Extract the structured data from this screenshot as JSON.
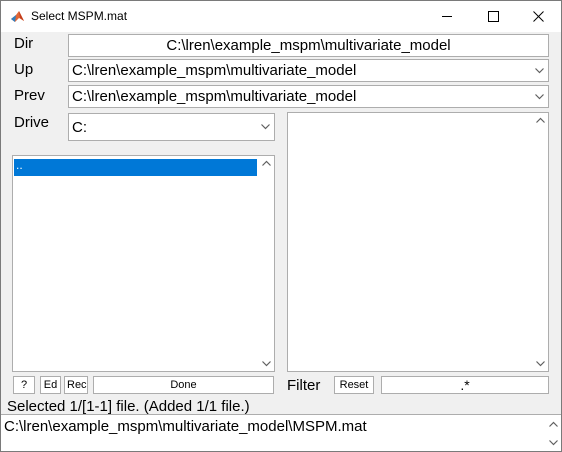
{
  "window": {
    "title": "Select MSPM.mat",
    "minimize_icon": "minimize-icon",
    "maximize_icon": "maximize-icon",
    "close_icon": "close-icon"
  },
  "dir": {
    "label": "Dir",
    "value": "C:\\lren\\example_mspm\\multivariate_model"
  },
  "up": {
    "label": "Up",
    "value": "C:\\lren\\example_mspm\\multivariate_model"
  },
  "prev": {
    "label": "Prev",
    "value": "C:\\lren\\example_mspm\\multivariate_model"
  },
  "drive": {
    "label": "Drive",
    "value": "C:"
  },
  "dir_list": {
    "items": [
      ".."
    ],
    "selected_index": 0
  },
  "file_list": {
    "items": []
  },
  "buttons": {
    "help": "?",
    "edit": "Ed",
    "rec": "Rec",
    "done": "Done",
    "reset": "Reset"
  },
  "filter": {
    "label": "Filter",
    "value": ".*"
  },
  "status": "Selected 1/[1-1] file. (Added 1/1 file.)",
  "selection": {
    "value": "C:\\lren\\example_mspm\\multivariate_model\\MSPM.mat"
  },
  "colors": {
    "selection": "#0078d7",
    "background": "#f0f0f0",
    "border": "#adadad"
  }
}
